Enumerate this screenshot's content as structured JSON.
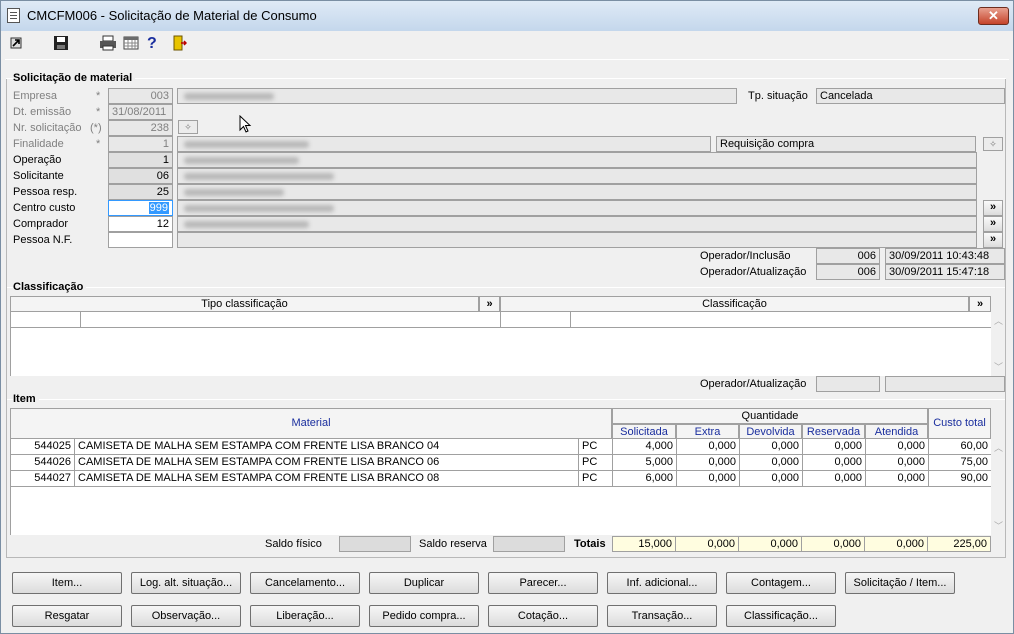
{
  "window": {
    "title": "CMCFM006 - Solicitação de Material de Consumo",
    "close_label": "✕"
  },
  "toolbar": {
    "icons": [
      "exit-icon",
      "save-icon",
      "print-icon",
      "calendar-grid-icon",
      "help-icon",
      "door-exit-icon"
    ],
    "help_glyph": "?"
  },
  "solicitacao": {
    "group_title": "Solicitação de material",
    "empresa": {
      "label": "Empresa",
      "mark": "*",
      "value": "003"
    },
    "dt_emissao": {
      "label": "Dt. emissão",
      "mark": "*",
      "value": "31/08/2011"
    },
    "nr_solicitacao": {
      "label": "Nr. solicitação",
      "mark": "(*)",
      "value": "238"
    },
    "finalidade": {
      "label": "Finalidade",
      "mark": "*",
      "value": "1",
      "extra": "Requisição compra"
    },
    "operacao": {
      "label": "Operação",
      "value": "1"
    },
    "solicitante": {
      "label": "Solicitante",
      "value": "06"
    },
    "pessoa_resp": {
      "label": "Pessoa resp.",
      "value": "25"
    },
    "centro_custo": {
      "label": "Centro custo",
      "value": "999"
    },
    "comprador": {
      "label": "Comprador",
      "value": "12"
    },
    "pessoa_nf": {
      "label": "Pessoa N.F.",
      "value": ""
    },
    "tp_situacao": {
      "label": "Tp. situação",
      "value": "Cancelada"
    },
    "expand_glyph": "»",
    "operador_inclusao": {
      "label": "Operador/Inclusão",
      "code": "006",
      "datetime": "30/09/2011 10:43:48"
    },
    "operador_atualizacao": {
      "label": "Operador/Atualização",
      "code": "006",
      "datetime": "30/09/2011 15:47:18"
    }
  },
  "classificacao": {
    "group_title": "Classificação",
    "col_tipo": "Tipo classificação",
    "col_classificacao": "Classificação",
    "operador_atualizacao": {
      "label": "Operador/Atualização",
      "code": "",
      "datetime": ""
    }
  },
  "item": {
    "group_title": "Item",
    "col_material": "Material",
    "col_quantidade": "Quantidade",
    "col_solicitada": "Solicitada",
    "col_extra": "Extra",
    "col_devolvida": "Devolvida",
    "col_reservada": "Reservada",
    "col_atendida": "Atendida",
    "col_custo_total": "Custo total",
    "rows": [
      {
        "code": "544025",
        "desc": "CAMISETA DE MALHA SEM ESTAMPA COM FRENTE LISA BRANCO 04",
        "un": "PC",
        "solicitada": "4,000",
        "extra": "0,000",
        "devolvida": "0,000",
        "reservada": "0,000",
        "atendida": "0,000",
        "custo": "60,00"
      },
      {
        "code": "544026",
        "desc": "CAMISETA DE MALHA SEM ESTAMPA COM FRENTE LISA BRANCO 06",
        "un": "PC",
        "solicitada": "5,000",
        "extra": "0,000",
        "devolvida": "0,000",
        "reservada": "0,000",
        "atendida": "0,000",
        "custo": "75,00"
      },
      {
        "code": "544027",
        "desc": "CAMISETA DE MALHA SEM ESTAMPA COM FRENTE LISA BRANCO 08",
        "un": "PC",
        "solicitada": "6,000",
        "extra": "0,000",
        "devolvida": "0,000",
        "reservada": "0,000",
        "atendida": "0,000",
        "custo": "90,00"
      }
    ],
    "saldo_fisico_label": "Saldo físico",
    "saldo_reserva_label": "Saldo reserva",
    "totais_label": "Totais",
    "totals": {
      "solicitada": "15,000",
      "extra": "0,000",
      "devolvida": "0,000",
      "reservada": "0,000",
      "atendida": "0,000",
      "custo": "225,00"
    }
  },
  "buttons": {
    "row1": [
      "Item...",
      "Log. alt. situação...",
      "Cancelamento...",
      "Duplicar",
      "Parecer...",
      "Inf. adicional...",
      "Contagem...",
      "Solicitação / Item..."
    ],
    "row2": [
      "Resgatar",
      "Observação...",
      "Liberação...",
      "Pedido compra...",
      "Cotação...",
      "Transação...",
      "Classificação..."
    ]
  }
}
